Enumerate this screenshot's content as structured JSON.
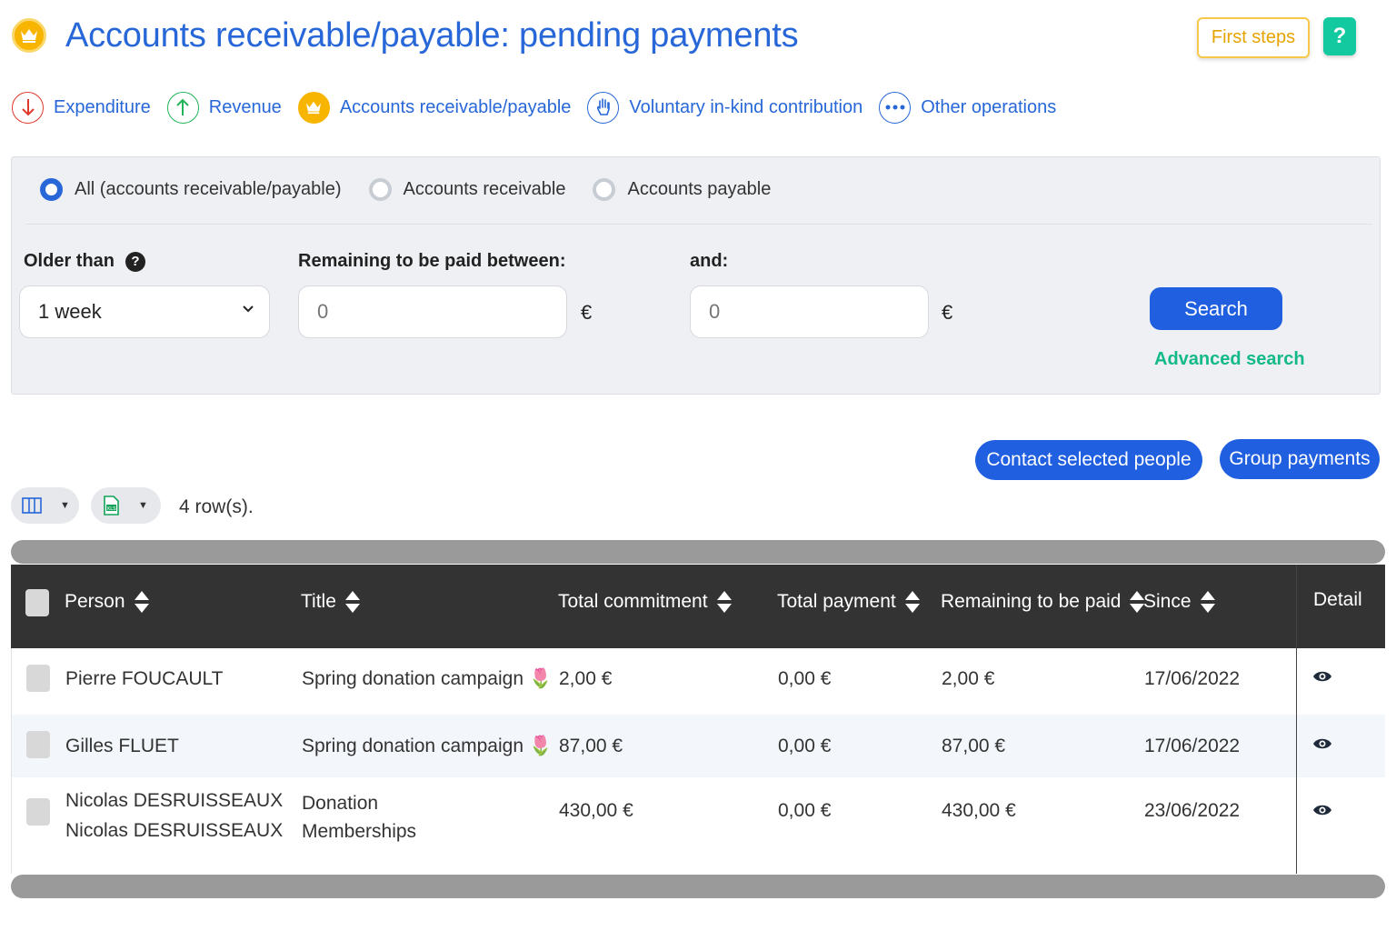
{
  "header": {
    "title": "Accounts receivable/payable: pending payments",
    "first_steps_label": "First steps",
    "help_label": "?"
  },
  "nav": {
    "items": [
      {
        "label": "Expenditure",
        "color": "#e0392b",
        "icon": "arrow-down-icon"
      },
      {
        "label": "Revenue",
        "color": "#23b35a",
        "icon": "arrow-up-icon"
      },
      {
        "label": "Accounts receivable/payable",
        "color": "#f7b500",
        "icon": "crown-icon"
      },
      {
        "label": "Voluntary in-kind contribution",
        "color": "#2767d8",
        "icon": "hand-icon"
      },
      {
        "label": "Other operations",
        "color": "#2767d8",
        "icon": "more-icon"
      }
    ]
  },
  "filters": {
    "radios": [
      {
        "label": "All (accounts receivable/payable)",
        "checked": true
      },
      {
        "label": "Accounts receivable",
        "checked": false
      },
      {
        "label": "Accounts payable",
        "checked": false
      }
    ],
    "older_than_label": "Older than",
    "older_than_value": "1 week",
    "remaining_label": "Remaining to be paid between:",
    "remaining_min_placeholder": "0",
    "and_label": "and:",
    "remaining_max_placeholder": "0",
    "currency": "€",
    "search_label": "Search",
    "advanced_search_label": "Advanced search"
  },
  "actions": {
    "contact_label": "Contact selected people",
    "group_label": "Group payments"
  },
  "toolbar": {
    "rows_count": "4 row(s)."
  },
  "table": {
    "columns": [
      "Person",
      "Title",
      "Total commitment",
      "Total payment",
      "Remaining to be paid",
      "Since",
      "Detail"
    ],
    "rows": [
      {
        "person": "Pierre FOUCAULT",
        "person2": "",
        "title": "Spring donation campaign",
        "title2": "",
        "emoji": "🌷",
        "commitment": "2,00 €",
        "payment": "0,00 €",
        "remaining": "2,00 €",
        "since": "17/06/2022"
      },
      {
        "person": "Gilles FLUET",
        "person2": "",
        "title": "Spring donation campaign",
        "title2": "",
        "emoji": "🌷",
        "commitment": "87,00 €",
        "payment": "0,00 €",
        "remaining": "87,00 €",
        "since": "17/06/2022"
      },
      {
        "person": "Nicolas DESRUISSEAUX",
        "person2": "Nicolas DESRUISSEAUX",
        "title": "Donation",
        "title2": "Memberships",
        "emoji": "",
        "commitment": "430,00 €",
        "payment": "0,00 €",
        "remaining": "430,00 €",
        "since": "23/06/2022"
      }
    ]
  }
}
